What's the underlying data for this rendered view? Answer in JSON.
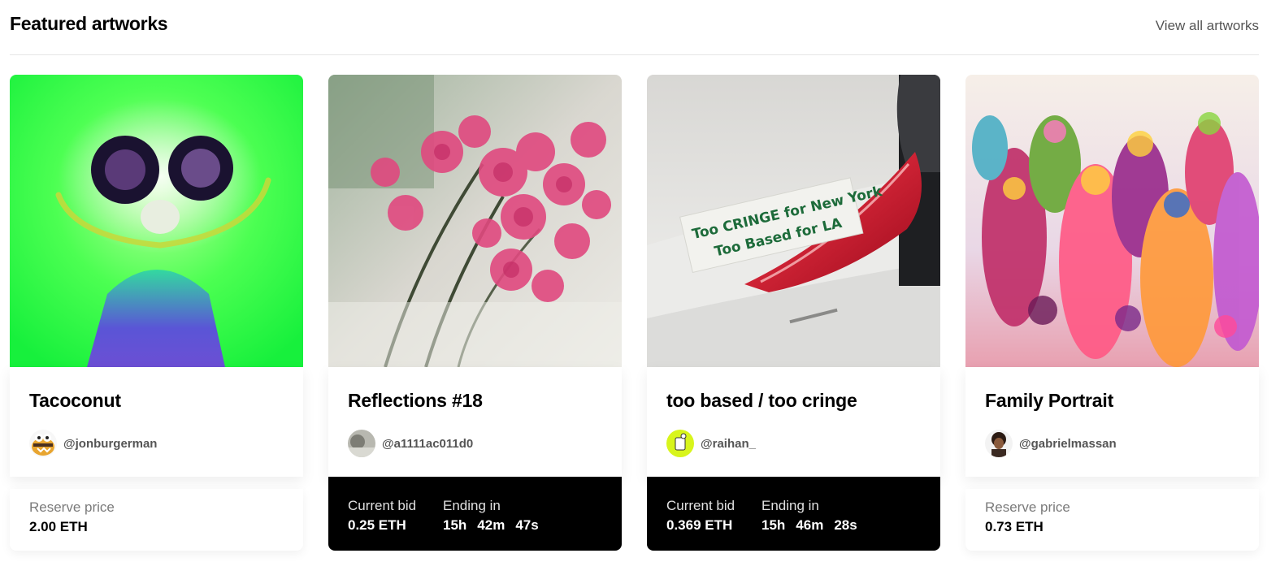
{
  "header": {
    "title": "Featured artworks",
    "view_all": "View all artworks"
  },
  "cards": [
    {
      "title": "Tacoconut",
      "creator": "@jonburgerman",
      "status": "reserve",
      "price_label": "Reserve price",
      "price": "2.00 ETH"
    },
    {
      "title": "Reflections #18",
      "creator": "@a1111ac011d0",
      "status": "live",
      "bid_label": "Current bid",
      "bid": "0.25 ETH",
      "ending_label": "Ending in",
      "ending": {
        "h": "15h",
        "m": "42m",
        "s": "47s"
      }
    },
    {
      "title": "too based / too cringe",
      "creator": "@raihan_",
      "status": "live",
      "bid_label": "Current bid",
      "bid": "0.369 ETH",
      "ending_label": "Ending in",
      "ending": {
        "h": "15h",
        "m": "46m",
        "s": "28s"
      },
      "sticker_line1": "Too CRINGE for New York",
      "sticker_line2": "Too Based for LA"
    },
    {
      "title": "Family Portrait",
      "creator": "@gabrielmassan",
      "status": "reserve",
      "price_label": "Reserve price",
      "price": "0.73 ETH"
    }
  ],
  "colors": {
    "accent": "#000000",
    "muted_text": "#7a7a7a",
    "handle_text": "#555555",
    "divider": "#e6e6e6"
  }
}
